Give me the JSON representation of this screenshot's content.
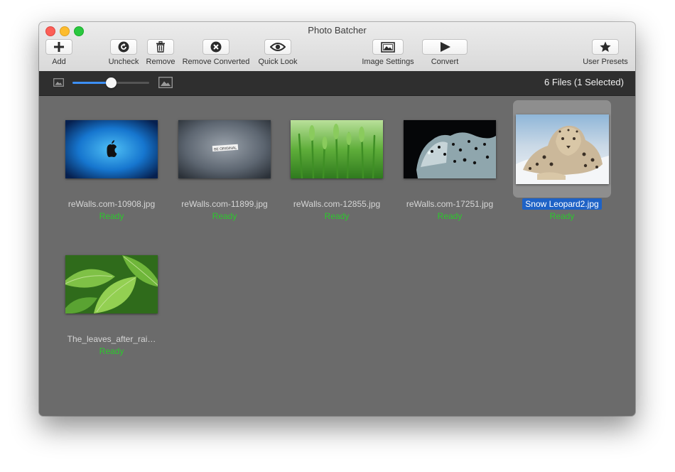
{
  "window": {
    "title": "Photo Batcher"
  },
  "toolbar": {
    "add": "Add",
    "uncheck": "Uncheck",
    "remove": "Remove",
    "remove_converted": "Remove Converted",
    "quick_look": "Quick Look",
    "image_settings": "Image Settings",
    "convert": "Convert",
    "user_presets": "User Presets"
  },
  "subbar": {
    "file_count": "6 Files (1 Selected)",
    "thumbnail_size_fraction": 0.5
  },
  "files": [
    {
      "name": "reWalls.com-10908.jpg",
      "status": "Ready",
      "selected": false,
      "thumbnail": "blue-apple-logo"
    },
    {
      "name": "reWalls.com-11899.jpg",
      "status": "Ready",
      "selected": false,
      "thumbnail": "gray-be-original"
    },
    {
      "name": "reWalls.com-12855.jpg",
      "status": "Ready",
      "selected": false,
      "thumbnail": "green-wheat"
    },
    {
      "name": "reWalls.com-17251.jpg",
      "status": "Ready",
      "selected": false,
      "thumbnail": "black-leopard"
    },
    {
      "name": "Snow Leopard2.jpg",
      "status": "Ready",
      "selected": true,
      "thumbnail": "snow-leopard"
    },
    {
      "name": "The_leaves_after_rai…",
      "status": "Ready",
      "selected": false,
      "thumbnail": "green-leaves"
    }
  ],
  "colors": {
    "status_ready": "#2dc82d",
    "selection": "#1e62c6",
    "slider_accent": "#3d8ff5"
  }
}
